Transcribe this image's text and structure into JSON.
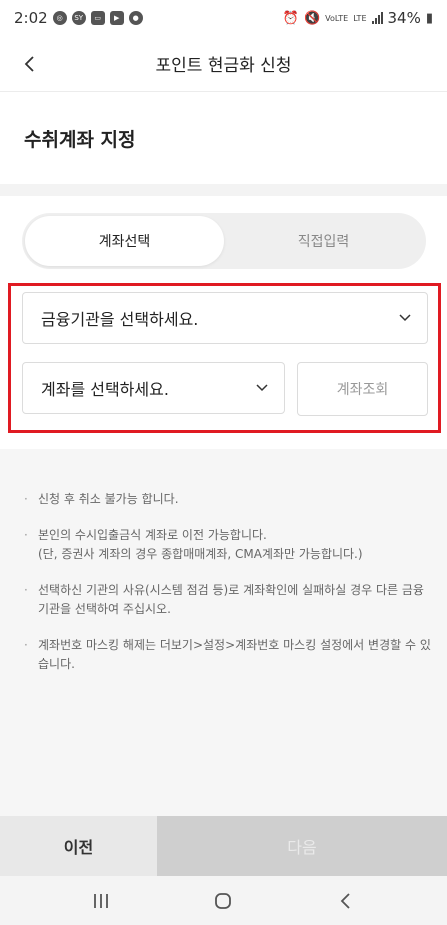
{
  "status_bar": {
    "time": "2:02",
    "battery": "34%",
    "network": "LTE"
  },
  "header": {
    "title": "포인트 현금화 신청"
  },
  "section": {
    "title": "수취계좌 지정"
  },
  "toggle": {
    "options": [
      "계좌선택",
      "직접입력"
    ],
    "selected": "계좌선택"
  },
  "form": {
    "bank_select": "금융기관을 선택하세요.",
    "account_select": "계좌를 선택하세요.",
    "lookup_button": "계좌조회"
  },
  "notices": [
    [
      "신청 후 취소 불가능 합니다."
    ],
    [
      "본인의 수시입출금식 계좌로 이전 가능합니다.",
      "(단, 증권사 계좌의 경우 종합매매계좌, CMA계좌만 가능합니다.)"
    ],
    [
      "선택하신 기관의 사유(시스템 점검 등)로 계좌확인에 실패하실 경우 다른 금융기관을 선택하여 주십시오."
    ],
    [
      "계좌번호 마스킹 해제는 더보기>설정>계좌번호 마스킹 설정에서 변경할 수 있습니다."
    ]
  ],
  "bottom": {
    "prev_label": "이전",
    "next_label": "다음"
  },
  "colors": {
    "highlight_outline": "#e01a22",
    "toggle_bg": "#efefef",
    "disabled_button": "#cfcfcf"
  }
}
